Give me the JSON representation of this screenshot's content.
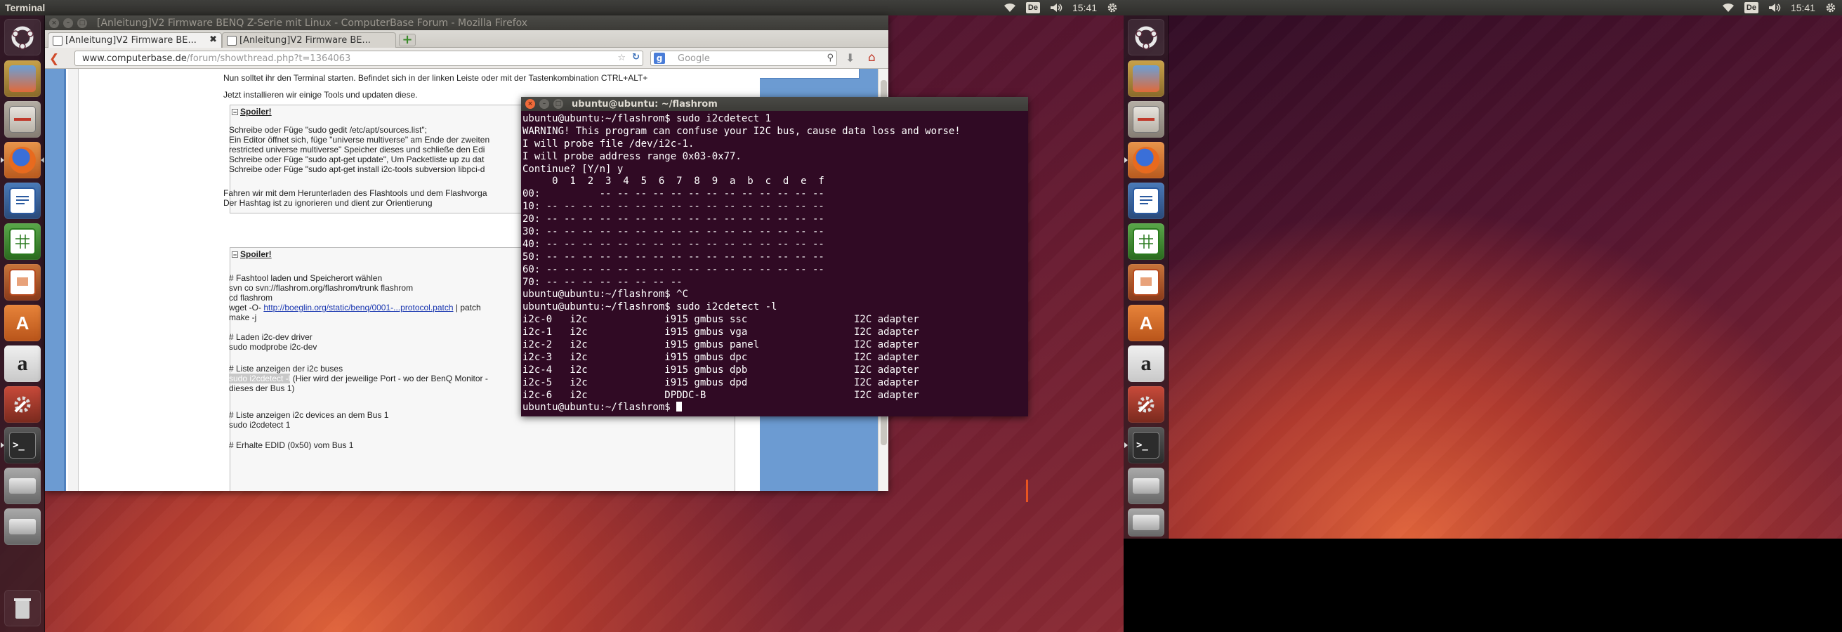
{
  "left_screen": {
    "panel": {
      "app_title": "Terminal",
      "keyboard_layout": "De",
      "clock": "15:41"
    },
    "launcher": {
      "items": [
        {
          "icon": "ubuntu-dash-icon",
          "active": false
        },
        {
          "icon": "image-viewer-icon",
          "active": false
        },
        {
          "icon": "files-icon",
          "active": false
        },
        {
          "icon": "firefox-icon",
          "active": true
        },
        {
          "icon": "libreoffice-writer-icon",
          "active": false
        },
        {
          "icon": "libreoffice-calc-icon",
          "active": false
        },
        {
          "icon": "libreoffice-impress-icon",
          "active": false
        },
        {
          "icon": "software-center-icon",
          "active": false
        },
        {
          "icon": "amazon-icon",
          "active": false
        },
        {
          "icon": "system-settings-icon",
          "active": false
        },
        {
          "icon": "terminal-icon",
          "active": true
        },
        {
          "icon": "drive-icon",
          "active": false
        },
        {
          "icon": "drive-icon",
          "active": false
        },
        {
          "icon": "trash-icon",
          "active": false
        }
      ],
      "terminal_glyph": ">_",
      "software_glyph": "A",
      "amazon_glyph": "a"
    },
    "firefox": {
      "window_title": "[Anleitung]V2 Firmware BENQ Z-Serie mit Linux - ComputerBase Forum - Mozilla Firefox",
      "tabs": [
        {
          "label": "[Anleitung]V2 Firmware BE...",
          "active": true
        },
        {
          "label": "[Anleitung]V2 Firmware BE...",
          "active": false
        }
      ],
      "new_tab_glyph": "+",
      "url_host": "www.computerbase.de",
      "url_path": "/forum/showthread.php?t=1364063",
      "search_placeholder": "Google",
      "content": {
        "line1": "Nun solltet ihr den Terminal starten. Befindet sich in der linken Leiste oder mit der Tastenkombination CTRL+ALT+",
        "line2": "Jetzt installieren wir einige Tools und updaten diese.",
        "spoiler1": {
          "label": "Spoiler!",
          "lines": [
            "Schreibe oder Füge \"sudo gedit /etc/apt/sources.list\";",
            "Ein Editor öffnet sich, füge \"universe multiverse\" am Ende der zweiten",
            "restricted universe multiverse\" Speicher dieses und schließe den Edi",
            "Schreibe oder Füge \"sudo apt-get update\", Um Packetliste up zu dat",
            "Schreibe oder Füge \"sudo apt-get install i2c-tools subversion libpci-d"
          ]
        },
        "line3": "Fahren wir mit dem Herunterladen des Flashtools und dem Flashvorga",
        "line4": "Der Hashtag ist zu ignorieren und dient zur Orientierung",
        "spoiler2": {
          "label": "Spoiler!",
          "c1": "# Fashtool laden und Speicherort wählen",
          "c2": "svn co svn://flashrom.org/flashrom/trunk flashrom",
          "c3": "cd flashrom",
          "c4_pre": "wget -O- ",
          "c4_link": "http://boeglin.org/static/benq/0001-...protocol.patch",
          "c4_post": " | patch",
          "c5": "make -j",
          "c6": "# Laden i2c-dev driver",
          "c7": "sudo modprobe i2c-dev",
          "c8": "# Liste anzeigen der i2c buses",
          "c9_hl": "sudo i2cdetect -l",
          "c9_post": " (Hier wird der jeweilige Port - wo der BenQ Monitor -",
          "c10": "dieses der Bus 1)",
          "c11": "# Liste anzeigen i2c devices an dem Bus 1",
          "c12": "sudo i2cdetect 1",
          "c13": "# Erhalte EDID (0x50) vom Bus 1"
        }
      }
    },
    "terminal": {
      "window_title": "ubuntu@ubuntu: ~/flashrom",
      "lines": [
        "ubuntu@ubuntu:~/flashrom$ sudo i2cdetect 1",
        "WARNING! This program can confuse your I2C bus, cause data loss and worse!",
        "I will probe file /dev/i2c-1.",
        "I will probe address range 0x03-0x77.",
        "Continue? [Y/n] y",
        "     0  1  2  3  4  5  6  7  8  9  a  b  c  d  e  f",
        "00:          -- -- -- -- -- -- -- -- -- -- -- -- --",
        "10: -- -- -- -- -- -- -- -- -- -- -- -- -- -- -- --",
        "20: -- -- -- -- -- -- -- -- -- -- -- -- -- -- -- --",
        "30: -- -- -- -- -- -- -- -- -- -- -- -- -- -- -- --",
        "40: -- -- -- -- -- -- -- -- -- -- -- -- -- -- -- --",
        "50: -- -- -- -- -- -- -- -- -- -- -- -- -- -- -- --",
        "60: -- -- -- -- -- -- -- -- -- -- -- -- -- -- -- --",
        "70: -- -- -- -- -- -- -- --",
        "ubuntu@ubuntu:~/flashrom$ ^C",
        "ubuntu@ubuntu:~/flashrom$ sudo i2cdetect -l",
        "i2c-0   i2c             i915 gmbus ssc                  I2C adapter",
        "i2c-1   i2c             i915 gmbus vga                  I2C adapter",
        "i2c-2   i2c             i915 gmbus panel                I2C adapter",
        "i2c-3   i2c             i915 gmbus dpc                  I2C adapter",
        "i2c-4   i2c             i915 gmbus dpb                  I2C adapter",
        "i2c-5   i2c             i915 gmbus dpd                  I2C adapter",
        "i2c-6   i2c             DPDDC-B                         I2C adapter"
      ],
      "prompt": "ubuntu@ubuntu:~/flashrom$ "
    }
  },
  "right_screen": {
    "panel": {
      "keyboard_layout": "De",
      "clock": "15:41"
    }
  }
}
